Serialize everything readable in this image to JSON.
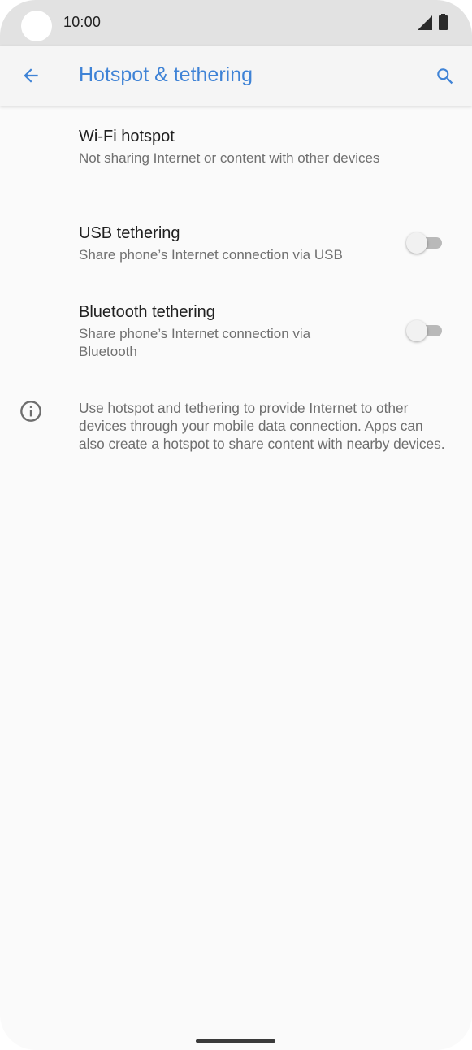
{
  "status_bar": {
    "time": "10:00",
    "icons": [
      "signal-icon",
      "battery-icon"
    ]
  },
  "app_bar": {
    "title": "Hotspot & tethering",
    "back_icon": "arrow-back-icon",
    "search_icon": "search-icon",
    "accent_color": "#3f83d6"
  },
  "settings": [
    {
      "title": "Wi-Fi hotspot",
      "summary": "Not sharing Internet or content with other devices"
    },
    {
      "title": "USB tethering",
      "summary": "Share phone’s Internet connection via USB",
      "enabled": false
    },
    {
      "title": "Bluetooth tethering",
      "summary": "Share phone’s Internet connection via Bluetooth",
      "enabled": false
    }
  ],
  "info": {
    "icon": "info-icon",
    "text": "Use hotspot and tethering to provide Internet to other devices through your mobile data connection. Apps can also create a hotspot to share content with nearby devices."
  }
}
